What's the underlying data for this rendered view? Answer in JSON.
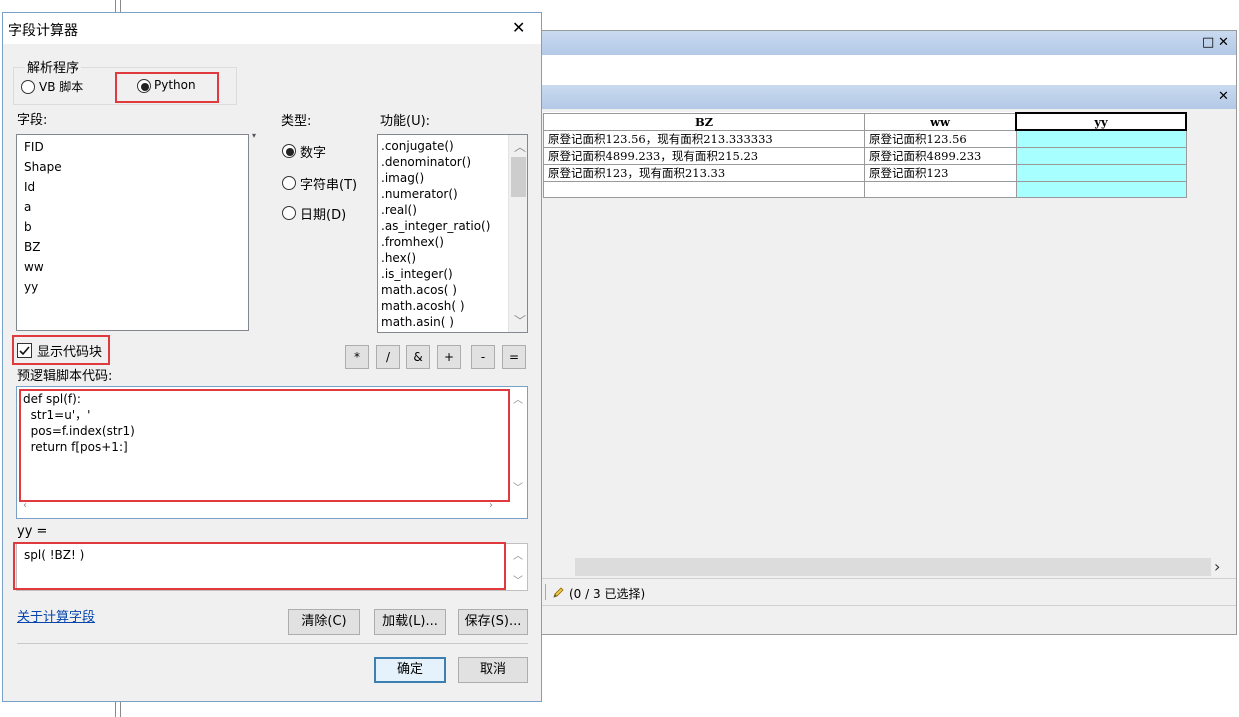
{
  "table_window": {
    "columns": [
      "BZ",
      "ww",
      "yy"
    ],
    "rows": [
      [
        "原登记面积123.56，现有面积213.333333",
        "原登记面积123.56",
        ""
      ],
      [
        "原登记面积4899.233，现有面积215.23",
        "原登记面积4899.233",
        ""
      ],
      [
        "原登记面积123，现有面积213.33",
        "原登记面积123",
        ""
      ],
      [
        "",
        "",
        ""
      ]
    ],
    "status_text": "(0 / 3 已选择)",
    "restore_glyph": "□",
    "close_glyph": "✕",
    "scroll_right_glyph": "›",
    "edit_icon": "pencil-icon"
  },
  "dialog": {
    "title": "字段计算器",
    "close_glyph": "✕",
    "parser_group_label": "解析程序",
    "parser_options": [
      "VB 脚本",
      "Python"
    ],
    "parser_selected": "Python",
    "fields_label": "字段:",
    "fields": [
      "FID",
      "Shape",
      "Id",
      "a",
      "b",
      "BZ",
      "ww",
      "yy"
    ],
    "type_label": "类型:",
    "types": [
      "数字",
      "字符串(T)",
      "日期(D)"
    ],
    "type_selected": "数字",
    "functions_label": "功能(U):",
    "functions": [
      ".conjugate()",
      ".denominator()",
      ".imag()",
      ".numerator()",
      ".real()",
      ".as_integer_ratio()",
      ".fromhex()",
      ".hex()",
      ".is_integer()",
      "math.acos( )",
      "math.acosh( )",
      "math.asin( )"
    ],
    "show_codeblock_label": "显示代码块",
    "show_codeblock_checked": true,
    "operators": [
      "*",
      "/",
      "&",
      "+",
      "-",
      "="
    ],
    "prelogic_label": "预逻辑脚本代码:",
    "prelogic_code": "def spl(f):\n  str1=u'，'\n  pos=f.index(str1)\n  return f[pos+1:]",
    "expression_label": "yy =",
    "expression_code": "spl( !BZ! )",
    "about_link": "关于计算字段",
    "clear_button": "清除(C)",
    "load_button": "加载(L)...",
    "save_button": "保存(S)...",
    "ok_button": "确定",
    "cancel_button": "取消"
  }
}
